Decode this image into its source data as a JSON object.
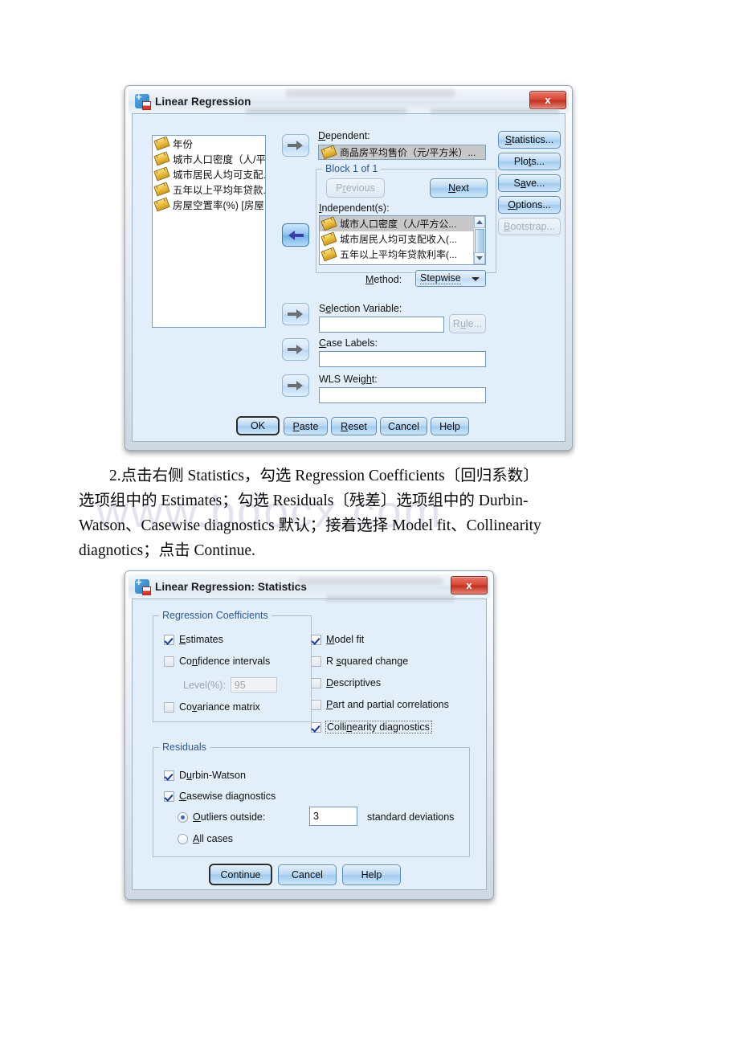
{
  "watermark": "www.bdocx.com",
  "dialog1": {
    "title": "Linear Regression",
    "close_label": "x",
    "source_vars": [
      "年份",
      "城市人口密度（人/平...",
      "城市居民人均可支配...",
      "五年以上平均年贷款...",
      "房屋空置率(%) [房屋..."
    ],
    "dependent_label": "Dependent:",
    "dependent_value": "商品房平均售价（元/平方米）...",
    "block_title": "Block 1 of 1",
    "previous_label": "Previous",
    "next_label": "Next",
    "independents_label": "Independent(s):",
    "independents": [
      "城市人口密度（人/平方公...",
      "城市居民人均可支配收入(...",
      "五年以上平均年贷款利率(..."
    ],
    "method_label": "Method:",
    "method_value": "Stepwise",
    "selection_variable_label": "Selection Variable:",
    "selection_variable_value": "",
    "rule_label": "Rule...",
    "case_labels_label": "Case Labels:",
    "case_labels_value": "",
    "wls_weight_label": "WLS Weight:",
    "wls_weight_value": "",
    "side_buttons": [
      {
        "label": "Statistics...",
        "disabled": false
      },
      {
        "label": "Plots...",
        "disabled": false
      },
      {
        "label": "Save...",
        "disabled": false
      },
      {
        "label": "Options...",
        "disabled": false
      },
      {
        "label": "Bootstrap...",
        "disabled": true
      }
    ],
    "bottom_buttons": [
      "OK",
      "Paste",
      "Reset",
      "Cancel",
      "Help"
    ]
  },
  "paragraph": {
    "line1": "2.点击右侧 Statistics，勾选 Regression Coefficients〔回归系数〕",
    "line2": "选项组中的 Estimates；勾选 Residuals〔残差〕选项组中的 Durbin-",
    "line3": "Watson、Casewise diagnostics 默认；接着选择 Model fit、Collinearity",
    "line4": "diagnotics；点击 Continue."
  },
  "dialog2": {
    "title": "Linear Regression: Statistics",
    "close_label": "x",
    "regression_coefficients": {
      "group_title": "Regression Coefficients",
      "items": [
        {
          "label": "Estimates",
          "checked": true
        },
        {
          "label": "Confidence intervals",
          "checked": false
        },
        {
          "label": "Covariance matrix",
          "checked": false
        }
      ],
      "level_label": "Level(%):",
      "level_value": "95"
    },
    "right_options": [
      {
        "label": "Model fit",
        "checked": true,
        "focused": false
      },
      {
        "label": "R squared change",
        "checked": false,
        "focused": false
      },
      {
        "label": "Descriptives",
        "checked": false,
        "focused": false
      },
      {
        "label": "Part and partial correlations",
        "checked": false,
        "focused": false
      },
      {
        "label": "Collinearity diagnostics",
        "checked": true,
        "focused": true
      }
    ],
    "residuals": {
      "group_title": "Residuals",
      "durbin_watson": {
        "label": "Durbin-Watson",
        "checked": true
      },
      "casewise": {
        "label": "Casewise diagnostics",
        "checked": true
      },
      "outliers": {
        "label": "Outliers outside:",
        "selected": true
      },
      "outliers_value": "3",
      "outliers_suffix": "standard deviations",
      "all_cases": {
        "label": "All cases",
        "selected": false
      }
    },
    "bottom_buttons": [
      "Continue",
      "Cancel",
      "Help"
    ]
  }
}
